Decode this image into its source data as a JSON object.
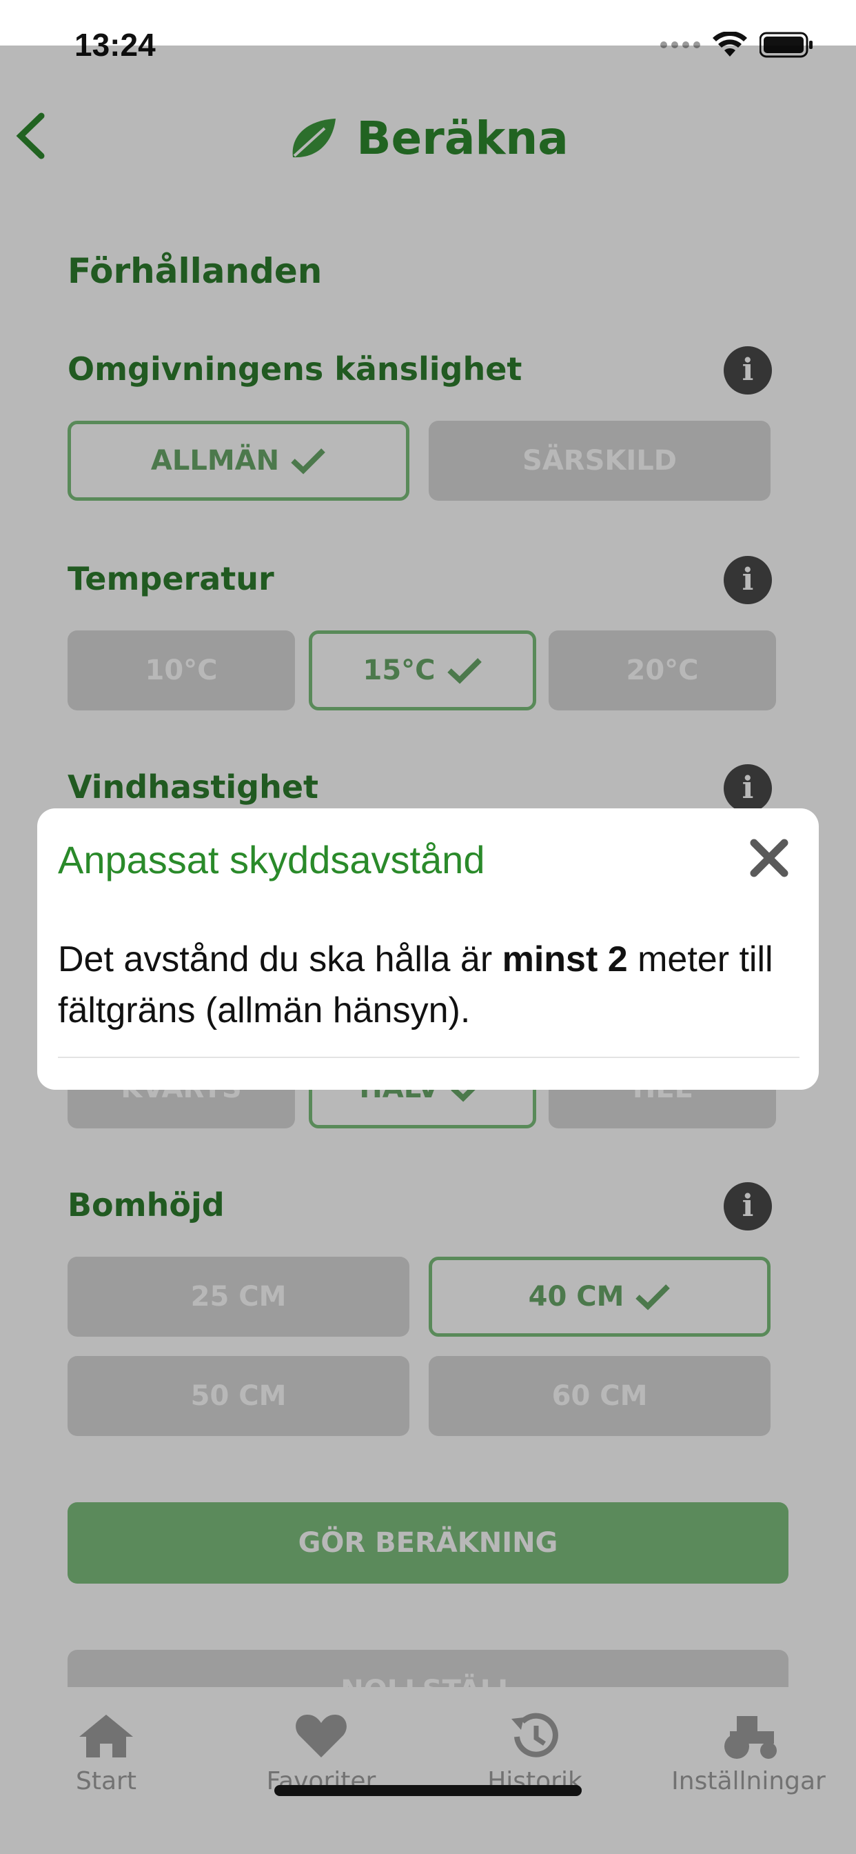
{
  "status_bar": {
    "time": "13:24"
  },
  "nav": {
    "title": "Beräkna",
    "back_icon": "chevron-left-icon",
    "logo_icon": "leaf-icon"
  },
  "conditions": {
    "heading": "Förhållanden",
    "sensitivity": {
      "label": "Omgivningens känslighet",
      "options": [
        "ALLMÄN",
        "SÄRSKILD"
      ],
      "selected": "ALLMÄN"
    },
    "temperature": {
      "label": "Temperatur",
      "options": [
        "10°C",
        "15°C",
        "20°C"
      ],
      "selected": "15°C"
    },
    "wind": {
      "label": "Vindhastighet"
    },
    "fraction": {
      "options": [
        "KVARTS",
        "HALV",
        "HEL"
      ],
      "selected": "HALV"
    },
    "boom_height": {
      "label": "Bomhöjd",
      "options": [
        "25 CM",
        "40 CM",
        "50 CM",
        "60 CM"
      ],
      "selected": "40 CM"
    }
  },
  "actions": {
    "calculate": "GÖR BERÄKNING",
    "reset": "NOLLSTÄLL"
  },
  "tabbar": {
    "items": [
      {
        "label": "Start",
        "icon": "home-icon"
      },
      {
        "label": "Favoriter",
        "icon": "heart-icon"
      },
      {
        "label": "Historik",
        "icon": "history-icon"
      },
      {
        "label": "Inställningar",
        "icon": "tractor-icon"
      }
    ]
  },
  "modal": {
    "title": "Anpassat skyddsavstånd",
    "body_before": "Det avstånd du ska hålla är ",
    "body_bold": "minst 2",
    "body_after": " meter till fältgräns (allmän hänsyn)."
  },
  "colors": {
    "accent": "#2f8a2f",
    "selected_border": "#7cc07c",
    "disabled": "#d9d9d9"
  }
}
